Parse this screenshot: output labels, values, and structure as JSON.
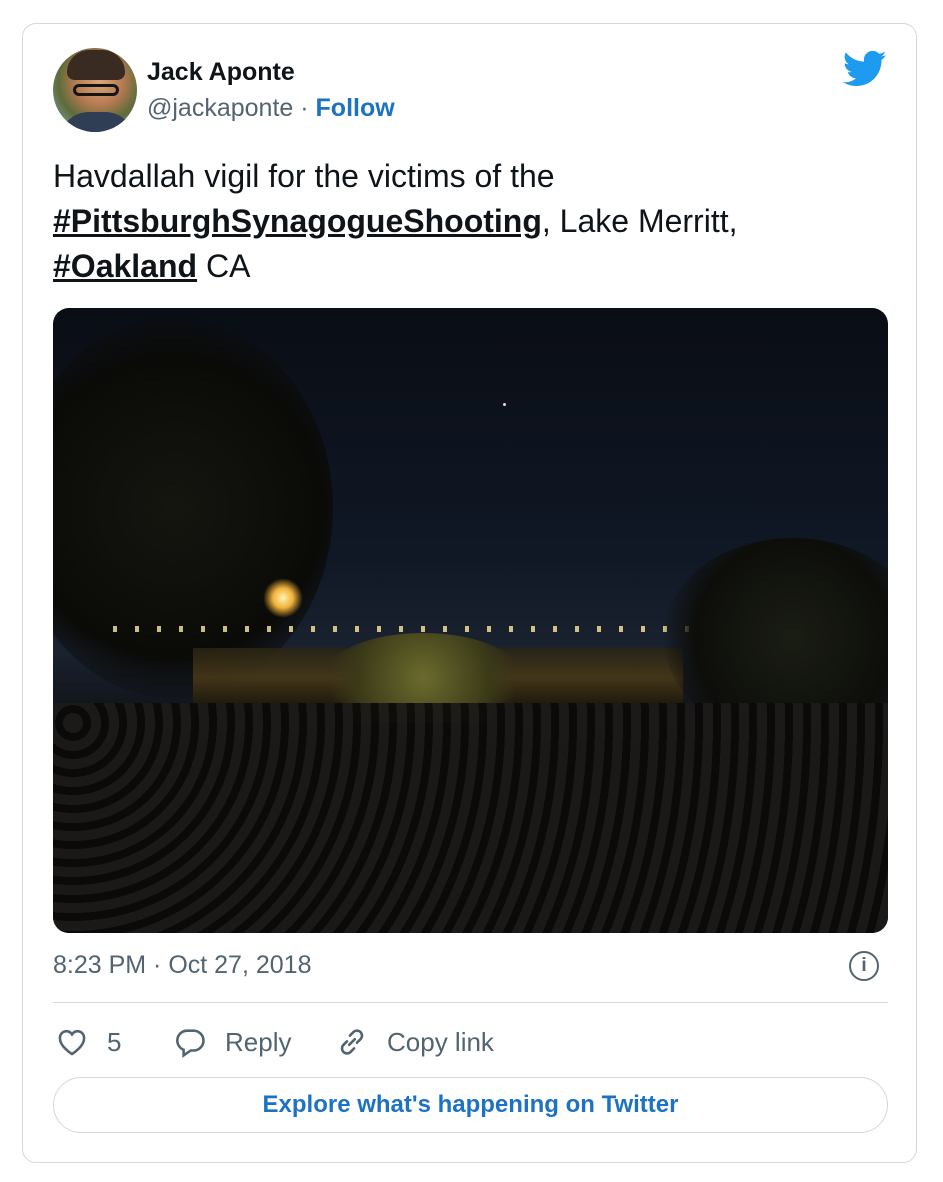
{
  "author": {
    "name": "Jack Aponte",
    "handle": "@jackaponte",
    "separator": " · ",
    "follow_label": "Follow"
  },
  "tweet": {
    "text_part1": "Havdallah vigil for the victims of the ",
    "hashtag1": "#PittsburghSynagogueShooting",
    "text_part2": ", Lake Merritt, ",
    "hashtag2": "#Oakland",
    "text_part3": " CA"
  },
  "meta": {
    "timestamp": "8:23 PM · Oct 27, 2018",
    "info_glyph": "i"
  },
  "actions": {
    "like_count": "5",
    "reply_label": "Reply",
    "copy_link_label": "Copy link"
  },
  "explore_label": "Explore what's happening on Twitter",
  "icons": {
    "brand": "twitter-bird-icon",
    "like": "heart-icon",
    "reply": "speech-bubble-icon",
    "copy": "link-icon",
    "info": "info-icon"
  },
  "colors": {
    "twitter_blue": "#1d9bf0",
    "link_blue": "#1d72c4",
    "muted_text": "#536471",
    "border": "#cfd9de"
  }
}
